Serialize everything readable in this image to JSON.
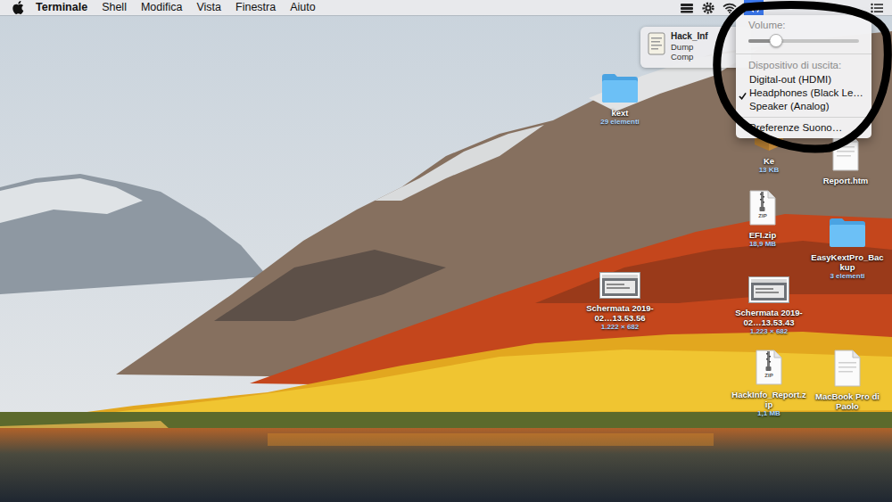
{
  "menu_bar": {
    "app": "Terminale",
    "menus": [
      "Shell",
      "Modifica",
      "Vista",
      "Finestra",
      "Aiuto"
    ],
    "volume_open": true
  },
  "notification": {
    "title": "Hack_Inf",
    "lines": [
      "Dump",
      "Comp"
    ]
  },
  "volume_menu": {
    "title": "Volume:",
    "level": 0.25,
    "section": "Dispositivo di uscita:",
    "devices": [
      {
        "label": "Digital-out (HDMI)",
        "selected": false
      },
      {
        "label": "Headphones (Black Le…",
        "selected": true
      },
      {
        "label": "Speaker (Analog)",
        "selected": false
      }
    ],
    "preferences": "Preferenze Suono…"
  },
  "desktop_icons": [
    {
      "label": "kext",
      "detail": "29 elementi",
      "kind": "folder"
    },
    {
      "label": "Ke",
      "detail": "13 KB",
      "kind": "package"
    },
    {
      "label": "Report.htm",
      "kind": "document"
    },
    {
      "label": "EFI.zip",
      "detail": "18,9 MB",
      "kind": "zip",
      "badge": "ZIP"
    },
    {
      "label": "EasyKextPro_Backup",
      "detail": "3 elementi",
      "kind": "folder"
    },
    {
      "label": "Schermata 2019-02…13.53.56",
      "detail": "1.222 × 682",
      "kind": "screenshot"
    },
    {
      "label": "Schermata 2019-02…13.53.43",
      "detail": "1.223 × 682",
      "kind": "screenshot"
    },
    {
      "label": "HackInfo_Report.zip",
      "detail": "1,1 MB",
      "kind": "zip",
      "badge": "ZIP"
    },
    {
      "label": "MacBook Pro di Paolo",
      "kind": "document"
    }
  ]
}
